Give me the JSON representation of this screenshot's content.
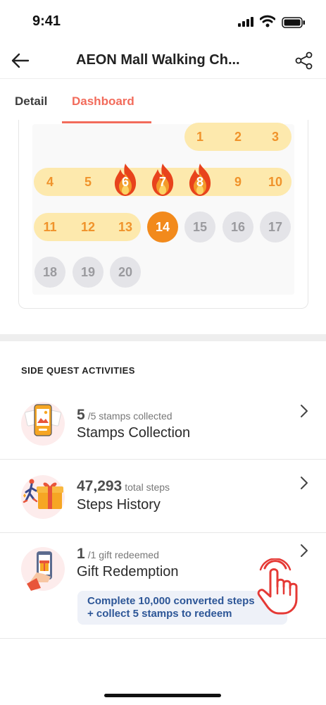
{
  "status_bar": {
    "time": "9:41"
  },
  "header": {
    "title": "AEON Mall Walking Ch..."
  },
  "tabs": [
    {
      "label": "Detail",
      "active": false
    },
    {
      "label": "Dashboard",
      "active": true
    }
  ],
  "calendar": {
    "days": [
      "1",
      "2",
      "3",
      "4",
      "5",
      "6",
      "7",
      "8",
      "9",
      "10",
      "11",
      "12",
      "13",
      "14",
      "15",
      "16",
      "17",
      "18",
      "19",
      "20"
    ],
    "streak_days": [
      "6",
      "7",
      "8"
    ],
    "today": "14"
  },
  "side_quest": {
    "title": "SIDE QUEST ACTIVITIES",
    "items": [
      {
        "count": "5",
        "count_sub": "/5 stamps collected",
        "name": "Stamps Collection",
        "icon": "phone-photo-icon"
      },
      {
        "count": "47,293",
        "count_sub": "total steps",
        "name": "Steps History",
        "icon": "runner-gift-icon"
      },
      {
        "count": "1",
        "count_sub": "/1 gift redeemed",
        "name": "Gift Redemption",
        "icon": "phone-gift-icon"
      }
    ],
    "hint_line1": "Complete 10,000 converted steps",
    "hint_line2": "+ collect 5 stamps to redeem"
  },
  "colors": {
    "accent": "#f26b5b",
    "streak_fill": "#fde9ad",
    "today": "#f28a1c",
    "hint_text": "#2d5697"
  }
}
